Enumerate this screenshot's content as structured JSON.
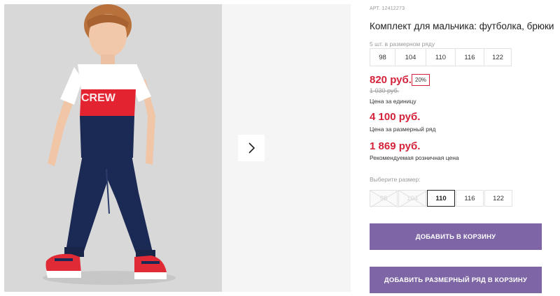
{
  "product": {
    "sku_label": "АРТ.",
    "sku": "12412273",
    "title": "Комплект для мальчика: футболка, брюки"
  },
  "size_row": {
    "label": "5 шт. в размерном ряду",
    "sizes": [
      "98",
      "104",
      "110",
      "116",
      "122"
    ]
  },
  "pricing": {
    "unit_price": "820 руб.",
    "discount": "20%",
    "old_price": "1 030 руб.",
    "unit_caption": "Цена за единицу",
    "row_price": "4 100 руб.",
    "row_caption": "Цена за размерный ряд",
    "retail_price": "1 869 руб.",
    "retail_caption": "Рекомендуемая розничная цена"
  },
  "size_picker": {
    "label": "Выберите размер:",
    "options": [
      {
        "label": "98",
        "state": "disabled"
      },
      {
        "label": "104",
        "state": "disabled"
      },
      {
        "label": "110",
        "state": "selected"
      },
      {
        "label": "116",
        "state": "available"
      },
      {
        "label": "122",
        "state": "available"
      }
    ]
  },
  "actions": {
    "add_to_cart": "ДОБАВИТЬ В КОРЗИНУ",
    "add_row_to_cart": "ДОБАВИТЬ РАЗМЕРНЫЙ РЯД В КОРЗИНУ"
  },
  "gallery": {
    "next_icon": "chevron-right-icon"
  },
  "colors": {
    "price_red": "#d4223b",
    "button_purple": "#7d65a6"
  }
}
